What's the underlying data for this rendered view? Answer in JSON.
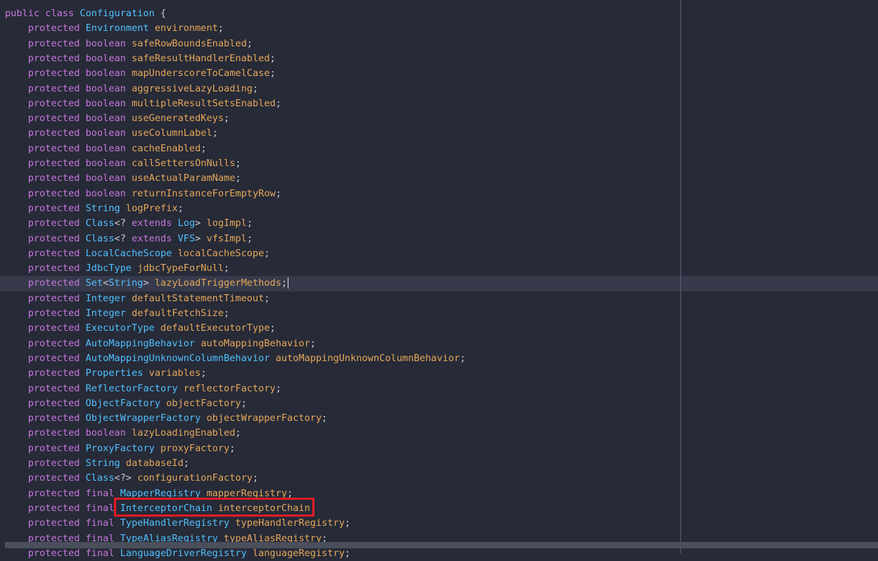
{
  "editor": {
    "current_line_index": 18,
    "highlighted_line_index": 33,
    "lines": [
      [
        "public class ",
        "Configuration",
        " {",
        ""
      ],
      [
        "    protected ",
        "Environment",
        " ",
        "environment",
        ";"
      ],
      [
        "    protected boolean ",
        "",
        "",
        "safeRowBoundsEnabled",
        ";"
      ],
      [
        "    protected boolean ",
        "",
        "",
        "safeResultHandlerEnabled",
        ";"
      ],
      [
        "    protected boolean ",
        "",
        "",
        "mapUnderscoreToCamelCase",
        ";"
      ],
      [
        "    protected boolean ",
        "",
        "",
        "aggressiveLazyLoading",
        ";"
      ],
      [
        "    protected boolean ",
        "",
        "",
        "multipleResultSetsEnabled",
        ";"
      ],
      [
        "    protected boolean ",
        "",
        "",
        "useGeneratedKeys",
        ";"
      ],
      [
        "    protected boolean ",
        "",
        "",
        "useColumnLabel",
        ";"
      ],
      [
        "    protected boolean ",
        "",
        "",
        "cacheEnabled",
        ";"
      ],
      [
        "    protected boolean ",
        "",
        "",
        "callSettersOnNulls",
        ";"
      ],
      [
        "    protected boolean ",
        "",
        "",
        "useActualParamName",
        ";"
      ],
      [
        "    protected boolean ",
        "",
        "",
        "returnInstanceForEmptyRow",
        ";"
      ],
      [
        "    protected ",
        "String",
        " ",
        "logPrefix",
        ";"
      ],
      [
        "    protected ",
        "Class",
        "<? extends Log> ",
        "logImpl",
        ";"
      ],
      [
        "    protected ",
        "Class",
        "<? extends VFS> ",
        "vfsImpl",
        ";"
      ],
      [
        "    protected ",
        "LocalCacheScope",
        " ",
        "localCacheScope",
        ";"
      ],
      [
        "    protected ",
        "JdbcType",
        " ",
        "jdbcTypeForNull",
        ";"
      ],
      [
        "    protected ",
        "Set",
        "<String> ",
        "lazyLoadTriggerMethods",
        ";"
      ],
      [
        "    protected ",
        "Integer",
        " ",
        "defaultStatementTimeout",
        ";"
      ],
      [
        "    protected ",
        "Integer",
        " ",
        "defaultFetchSize",
        ";"
      ],
      [
        "    protected ",
        "ExecutorType",
        " ",
        "defaultExecutorType",
        ";"
      ],
      [
        "    protected ",
        "AutoMappingBehavior",
        " ",
        "autoMappingBehavior",
        ";"
      ],
      [
        "    protected ",
        "AutoMappingUnknownColumnBehavior",
        " ",
        "autoMappingUnknownColumnBehavior",
        ";"
      ],
      [
        "    protected ",
        "Properties",
        " ",
        "variables",
        ";"
      ],
      [
        "    protected ",
        "ReflectorFactory",
        " ",
        "reflectorFactory",
        ";"
      ],
      [
        "    protected ",
        "ObjectFactory",
        " ",
        "objectFactory",
        ";"
      ],
      [
        "    protected ",
        "ObjectWrapperFactory",
        " ",
        "objectWrapperFactory",
        ";"
      ],
      [
        "    protected boolean ",
        "",
        "",
        "lazyLoadingEnabled",
        ";"
      ],
      [
        "    protected ",
        "ProxyFactory",
        " ",
        "proxyFactory",
        ";"
      ],
      [
        "    protected ",
        "String",
        " ",
        "databaseId",
        ";"
      ],
      [
        "    protected ",
        "Class",
        "<?> ",
        "configurationFactory",
        ";"
      ],
      [
        "    protected final ",
        "MapperRegistry",
        " ",
        "mapperRegistry",
        ";"
      ],
      [
        "    protected final ",
        "InterceptorChain",
        " ",
        "interceptorChain",
        ";"
      ],
      [
        "    protected final ",
        "TypeHandlerRegistry",
        " ",
        "typeHandlerRegistry",
        ";"
      ],
      [
        "    protected final ",
        "TypeAliasRegistry",
        " ",
        "typeAliasRegistry",
        ";"
      ],
      [
        "    protected final ",
        "LanguageDriverRegistry",
        " ",
        "languageRegistry",
        ";"
      ]
    ]
  }
}
